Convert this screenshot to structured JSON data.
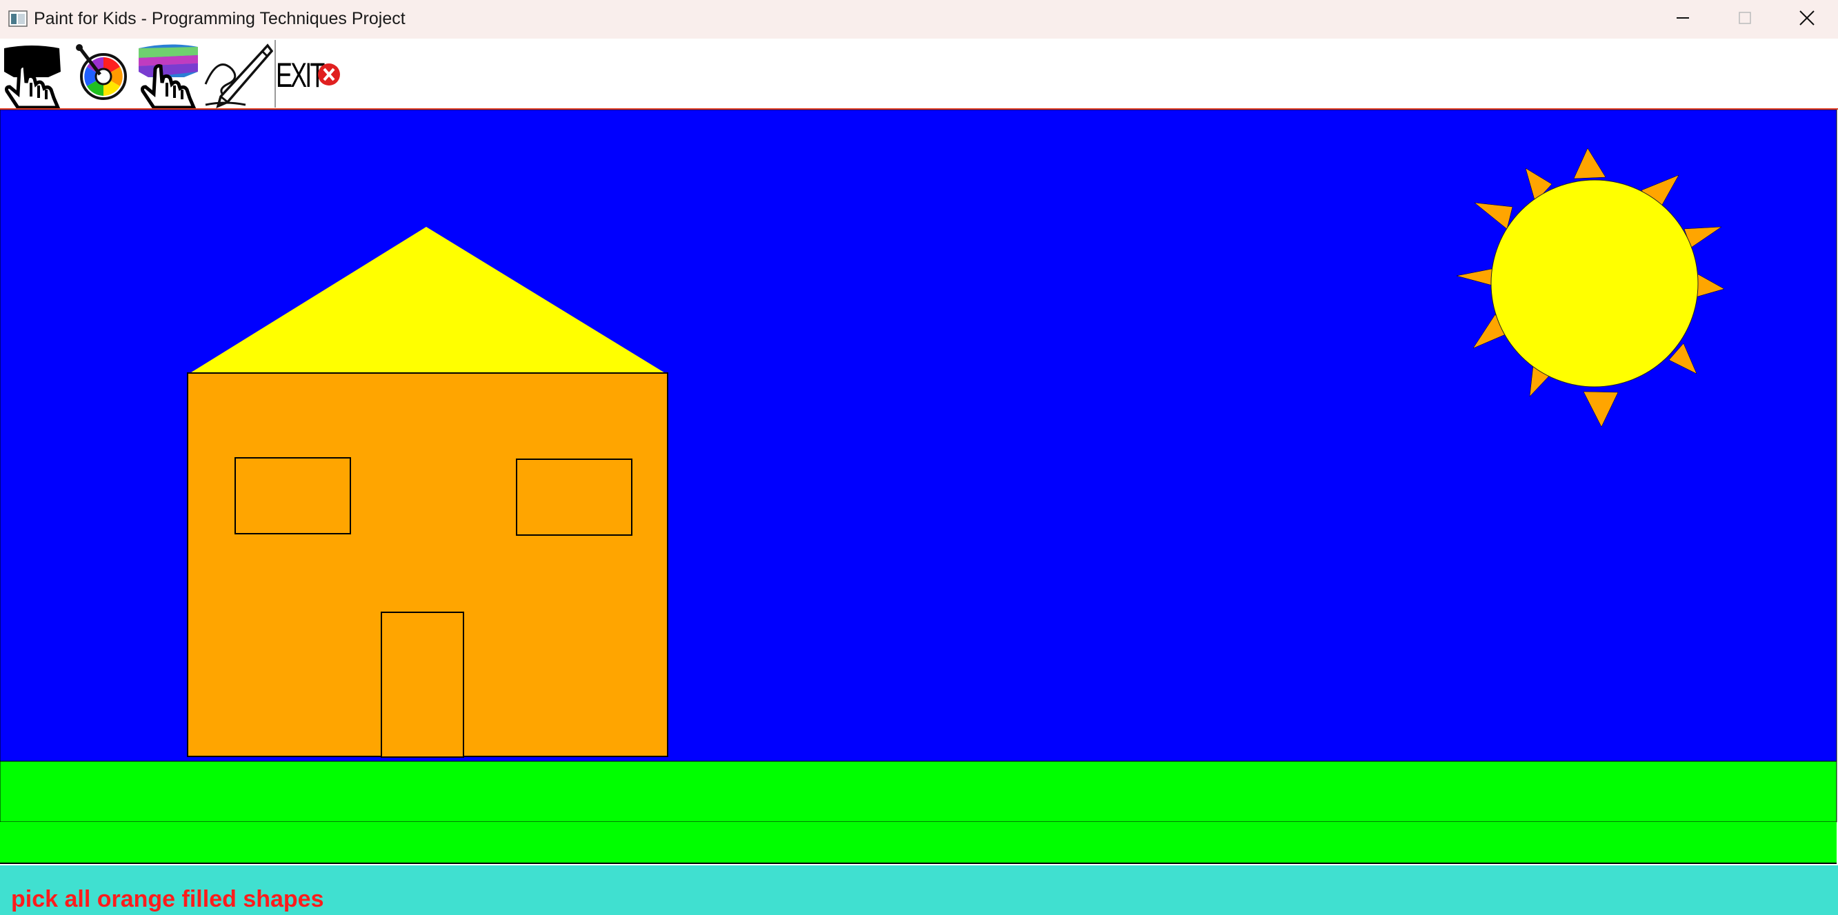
{
  "window": {
    "title": "Paint for Kids - Programming Techniques Project",
    "controls": [
      "minimize",
      "maximize",
      "close"
    ]
  },
  "toolbar": {
    "items": [
      {
        "name": "select-tool",
        "icon": "hand-pointer-black-icon"
      },
      {
        "name": "color-tool",
        "icon": "color-wheel-icon"
      },
      {
        "name": "fill-tool",
        "icon": "hand-pointer-rainbow-icon"
      },
      {
        "name": "draw-tool",
        "icon": "pencil-icon"
      },
      {
        "name": "exit-tool",
        "icon": "exit-icon"
      }
    ],
    "exit_label": "EXIT"
  },
  "canvas": {
    "colors": {
      "sky": "#0000ff",
      "grass": "#00ff00",
      "house_wall": "#ffa500",
      "roof": "#ffff00",
      "sun": "#ffff00",
      "sun_rays": "#ffa500"
    },
    "shapes": [
      "sky-rectangle",
      "grass-rectangle",
      "roof-triangle",
      "house-wall-rectangle",
      "left-window",
      "right-window",
      "door",
      "sun-circle",
      "sun-rays"
    ]
  },
  "status": {
    "message": "pick all orange filled shapes",
    "color": "#ff1c1c",
    "background": "#40e0d0"
  }
}
